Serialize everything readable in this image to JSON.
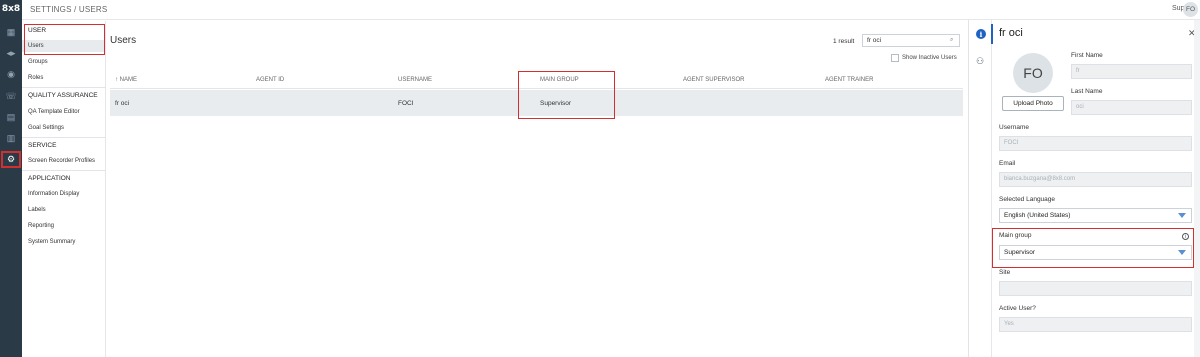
{
  "rail": {
    "logo": "8x8",
    "icons": [
      "dashboard-icon",
      "broadcast-icon",
      "eye-icon",
      "phone-icon",
      "id-card-icon",
      "bar-chart-icon",
      "gear-icon"
    ]
  },
  "header": {
    "breadcrumb": "SETTINGS / USERS",
    "support": "Support",
    "avatar_initials": "FO"
  },
  "sidenav": {
    "sections": [
      {
        "title": "USER",
        "items": [
          "Users",
          "Groups",
          "Roles"
        ]
      },
      {
        "title": "QUALITY ASSURANCE",
        "items": [
          "QA Template Editor",
          "Goal Settings"
        ]
      },
      {
        "title": "SERVICE",
        "items": [
          "Screen Recorder Profiles"
        ]
      },
      {
        "title": "APPLICATION",
        "items": [
          "Information Display",
          "Labels",
          "Reporting",
          "System Summary"
        ]
      }
    ],
    "selected": "Users"
  },
  "main": {
    "title": "Users",
    "result_count": "1 result",
    "search_value": "fr oci",
    "show_inactive_label": "Show Inactive Users",
    "columns": [
      "↑ NAME",
      "AGENT ID",
      "USERNAME",
      "MAIN GROUP",
      "AGENT SUPERVISOR",
      "AGENT TRAINER"
    ],
    "rows": [
      {
        "name": "fr oci",
        "agent_id": "",
        "username": "FOCI",
        "main_group": "Supervisor",
        "agent_supervisor": "",
        "agent_trainer": ""
      }
    ]
  },
  "panel": {
    "title": "fr oci",
    "avatar_initials": "FO",
    "upload_label": "Upload Photo",
    "first_name_label": "First Name",
    "first_name_value": "fr",
    "last_name_label": "Last Name",
    "last_name_value": "oci",
    "username_label": "Username",
    "username_value": "FOCI",
    "email_label": "Email",
    "email_value": "bianca.buzgana@8x8.com",
    "language_label": "Selected Language",
    "language_value": "English (United States)",
    "main_group_label": "Main group",
    "main_group_value": "Supervisor",
    "site_label": "Site",
    "site_value": "",
    "active_label": "Active User?",
    "active_value": "Yes"
  },
  "colors": {
    "rail_bg": "#2a3a47",
    "accent": "#1e63c4",
    "highlight_box": "#d32f2f",
    "row_bg": "#e9ecef"
  }
}
